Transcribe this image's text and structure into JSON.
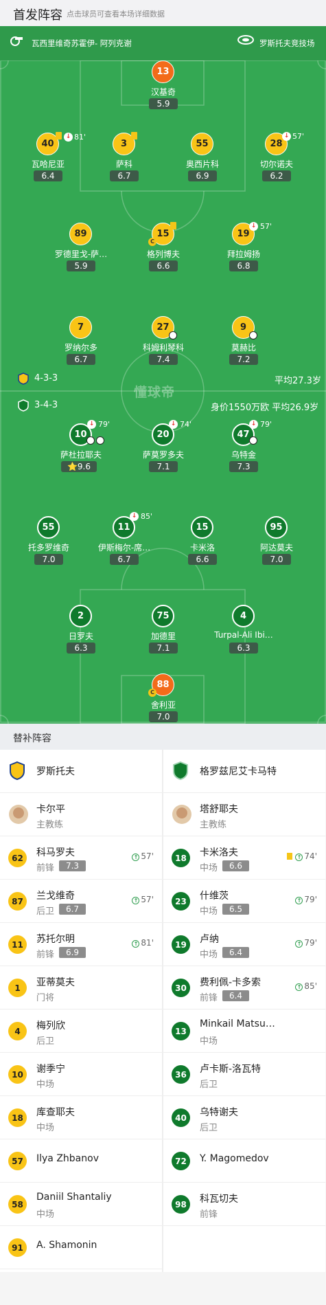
{
  "header": {
    "title": "首发阵容",
    "subtitle": "点击球员可查看本场详细数据"
  },
  "topbar": {
    "referee": "瓦西里维奇苏霍伊- 阿列克谢",
    "stadium": "罗斯托夫竞技场"
  },
  "watermark": "懂球帝",
  "home_info": {
    "formation": "4-3-3",
    "avg_age": "平均27.3岁"
  },
  "away_info": {
    "formation": "3-4-3",
    "value_age": "身价1550万欧 平均26.9岁"
  },
  "home_players": [
    {
      "num": "13",
      "name": "汉基奇",
      "rating": "5.9",
      "gk": true
    },
    {
      "num": "40",
      "name": "瓦哈尼亚",
      "rating": "6.4",
      "event": "81'"
    },
    {
      "num": "3",
      "name": "萨科",
      "rating": "6.7"
    },
    {
      "num": "55",
      "name": "奥西片科",
      "rating": "6.9"
    },
    {
      "num": "28",
      "name": "切尔诺夫",
      "rating": "6.2",
      "event": "57'"
    },
    {
      "num": "89",
      "name": "罗德里戈-萨…",
      "rating": "5.9"
    },
    {
      "num": "15",
      "name": "格列博夫",
      "rating": "6.6"
    },
    {
      "num": "19",
      "name": "拜拉姆扬",
      "rating": "6.8",
      "event": "57'"
    },
    {
      "num": "7",
      "name": "罗纳尔多",
      "rating": "6.7"
    },
    {
      "num": "27",
      "name": "科姆利琴科",
      "rating": "7.4"
    },
    {
      "num": "9",
      "name": "莫赫比",
      "rating": "7.2"
    }
  ],
  "away_players": [
    {
      "num": "10",
      "name": "萨杜拉耶夫",
      "rating": "9.6",
      "event": "79'"
    },
    {
      "num": "20",
      "name": "萨莫罗多夫",
      "rating": "7.1",
      "event": "74'"
    },
    {
      "num": "47",
      "name": "乌特金",
      "rating": "7.3",
      "event": "79'"
    },
    {
      "num": "55",
      "name": "托多罗维奇",
      "rating": "7.0"
    },
    {
      "num": "11",
      "name": "伊斯梅尔-席…",
      "rating": "6.7",
      "event": "85'"
    },
    {
      "num": "15",
      "name": "卡米洛",
      "rating": "6.6"
    },
    {
      "num": "95",
      "name": "阿达莫夫",
      "rating": "7.0"
    },
    {
      "num": "2",
      "name": "日罗夫",
      "rating": "6.3"
    },
    {
      "num": "75",
      "name": "加德里",
      "rating": "7.1"
    },
    {
      "num": "4",
      "name": "Turpal-Ali Ibi…",
      "rating": "6.3"
    },
    {
      "num": "88",
      "name": "舍利亚",
      "rating": "7.0",
      "gk": true
    }
  ],
  "subs": {
    "title": "替补阵容",
    "home_team": "罗斯托夫",
    "away_team": "格罗兹尼艾卡马特",
    "home_coach": {
      "name": "卡尔平",
      "role": "主教练"
    },
    "away_coach": {
      "name": "塔舒耶夫",
      "role": "主教练"
    },
    "home": [
      {
        "num": "62",
        "name": "科马罗夫",
        "pos": "前锋",
        "rating": "7.3",
        "minute": "57'"
      },
      {
        "num": "87",
        "name": "兰戈维奇",
        "pos": "后卫",
        "rating": "6.7",
        "minute": "57'"
      },
      {
        "num": "11",
        "name": "苏托尔明",
        "pos": "前锋",
        "rating": "6.9",
        "minute": "81'"
      },
      {
        "num": "1",
        "name": "亚蒂莫夫",
        "pos": "门将"
      },
      {
        "num": "4",
        "name": "梅列欣",
        "pos": "后卫"
      },
      {
        "num": "10",
        "name": "谢季宁",
        "pos": "中场"
      },
      {
        "num": "18",
        "name": "库查耶夫",
        "pos": "中场"
      },
      {
        "num": "57",
        "name": "Ilya Zhbanov",
        "pos": ""
      },
      {
        "num": "58",
        "name": "Daniil Shantaliy",
        "pos": "中场"
      },
      {
        "num": "91",
        "name": "A. Shamonin",
        "pos": ""
      }
    ],
    "away": [
      {
        "num": "18",
        "name": "卡米洛夫",
        "pos": "中场",
        "rating": "6.6",
        "minute": "74'",
        "card": true
      },
      {
        "num": "23",
        "name": "什维茨",
        "pos": "中场",
        "rating": "6.5",
        "minute": "79'"
      },
      {
        "num": "19",
        "name": "卢纳",
        "pos": "中场",
        "rating": "6.4",
        "minute": "79'"
      },
      {
        "num": "30",
        "name": "费利佩-卡多索",
        "pos": "前锋",
        "rating": "6.4",
        "minute": "85'"
      },
      {
        "num": "13",
        "name": "Minkail Matsu…",
        "pos": "中场"
      },
      {
        "num": "36",
        "name": "卢卡斯-洛瓦特",
        "pos": "后卫"
      },
      {
        "num": "40",
        "name": "乌特谢夫",
        "pos": "后卫"
      },
      {
        "num": "72",
        "name": "Y. Magomedov",
        "pos": ""
      },
      {
        "num": "98",
        "name": "科瓦切夫",
        "pos": "前锋"
      }
    ]
  },
  "colors": {
    "pitch": "#34a853",
    "home": "#f9c416",
    "away": "#0f7a2c",
    "gk": "#f36b1a"
  }
}
